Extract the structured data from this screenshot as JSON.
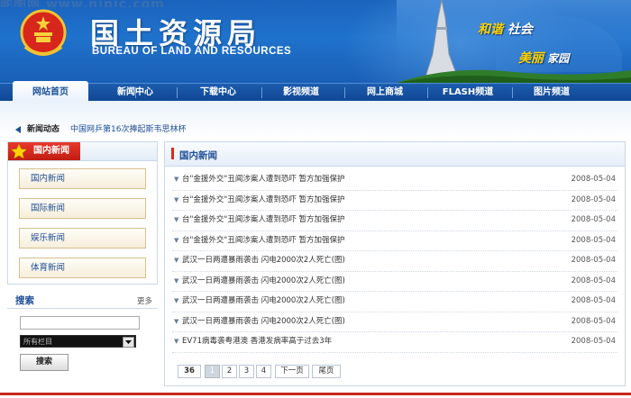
{
  "watermark": "昵图网 www.nipic.com",
  "header": {
    "title": "国土资源局",
    "subtitle": "BUREAU OF LAND AND RESOURCES",
    "slogan_line1_a": "和谐",
    "slogan_line1_b": "社会",
    "slogan_line2_a": "美丽",
    "slogan_line2_b": "家园"
  },
  "nav": {
    "items": [
      {
        "label": "网站首页"
      },
      {
        "label": "新闻中心"
      },
      {
        "label": "下载中心"
      },
      {
        "label": "影视频道"
      },
      {
        "label": "网上商城"
      },
      {
        "label": "FLASH频道"
      },
      {
        "label": "图片频道"
      }
    ]
  },
  "ticker": {
    "label": "新闻动态",
    "text": "中国网乒第16次捧起斯韦思林杯"
  },
  "sidebar": {
    "section_title": "国内新闻",
    "categories": [
      {
        "label": "国内新闻"
      },
      {
        "label": "国际新闻"
      },
      {
        "label": "娱乐新闻"
      },
      {
        "label": "体育新闻"
      }
    ],
    "search": {
      "title": "搜索",
      "more": "更多",
      "input_value": "",
      "select_value": "所有栏目",
      "button_label": "搜索"
    }
  },
  "main": {
    "title": "国内新闻",
    "news": [
      {
        "title": "台\"金援外交\"丑闻涉案人遭到恐吓 暂方加强保护",
        "date": "2008-05-04"
      },
      {
        "title": "台\"金援外交\"丑闻涉案人遭到恐吓 暂方加强保护",
        "date": "2008-05-04"
      },
      {
        "title": "台\"金援外交\"丑闻涉案人遭到恐吓 暂方加强保护",
        "date": "2008-05-04"
      },
      {
        "title": "台\"金援外交\"丑闻涉案人遭到恐吓 暂方加强保护",
        "date": "2008-05-04"
      },
      {
        "title": "武汉一日两遭暴雨袭击 闪电2000次2人死亡(图)",
        "date": "2008-05-04"
      },
      {
        "title": "武汉一日两遭暴雨袭击 闪电2000次2人死亡(图)",
        "date": "2008-05-04"
      },
      {
        "title": "武汉一日两遭暴雨袭击 闪电2000次2人死亡(图)",
        "date": "2008-05-04"
      },
      {
        "title": "武汉一日两遭暴雨袭击 闪电2000次2人死亡(图)",
        "date": "2008-05-04"
      },
      {
        "title": "EV71病毒袭粤港澳 香港发病率高于过去3年",
        "date": "2008-05-04"
      }
    ],
    "pager": {
      "total": "36",
      "pages": [
        "1",
        "2",
        "3",
        "4"
      ],
      "next": "下一页",
      "last": "尾页"
    }
  },
  "colors": {
    "header_blue": "#1f72cc",
    "nav_blue": "#0f4693",
    "accent_red": "#c01d12",
    "link_blue": "#1f4f96"
  }
}
